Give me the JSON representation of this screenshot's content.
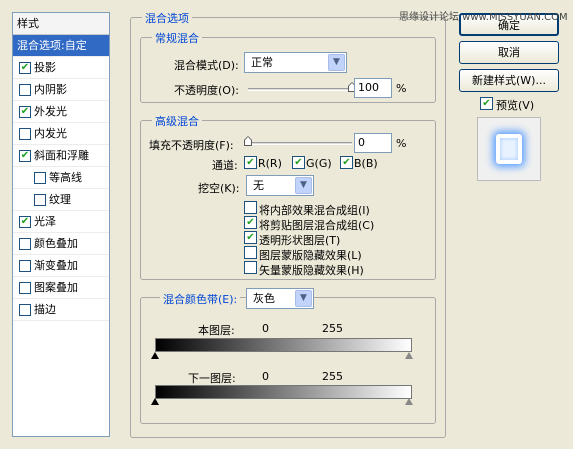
{
  "style_list": {
    "header": "样式",
    "items": [
      {
        "label": "混合选项:自定",
        "selected": true
      },
      {
        "label": "投影",
        "checked": true
      },
      {
        "label": "内阴影",
        "checked": false
      },
      {
        "label": "外发光",
        "checked": true
      },
      {
        "label": "内发光",
        "checked": false
      },
      {
        "label": "斜面和浮雕",
        "checked": true
      },
      {
        "label": "等高线",
        "checked": false
      },
      {
        "label": "纹理",
        "checked": false
      },
      {
        "label": "光泽",
        "checked": true
      },
      {
        "label": "颜色叠加",
        "checked": false
      },
      {
        "label": "渐变叠加",
        "checked": false
      },
      {
        "label": "图案叠加",
        "checked": false
      },
      {
        "label": "描边",
        "checked": false
      }
    ]
  },
  "blending": {
    "title": "混合选项",
    "general": {
      "title": "常规混合",
      "mode_label": "混合模式(D):",
      "mode_value": "正常",
      "opacity_label": "不透明度(O):",
      "opacity_value": "100",
      "opacity_fraction": 1.0,
      "percent": "%"
    },
    "advanced": {
      "title": "高级混合",
      "fill_label": "填充不透明度(F):",
      "fill_value": "0",
      "fill_fraction": 0.0,
      "percent": "%",
      "channels_label": "通道:",
      "channels": [
        {
          "label": "R(R)",
          "checked": true
        },
        {
          "label": "G(G)",
          "checked": true
        },
        {
          "label": "B(B)",
          "checked": true
        }
      ],
      "knockout_label": "挖空(K):",
      "knockout_value": "无",
      "options": [
        {
          "label": "将内部效果混合成组(I)",
          "checked": false
        },
        {
          "label": "将剪贴图层混合成组(C)",
          "checked": true
        },
        {
          "label": "透明形状图层(T)",
          "checked": true
        },
        {
          "label": "图层蒙版隐藏效果(L)",
          "checked": false
        },
        {
          "label": "矢量蒙版隐藏效果(H)",
          "checked": false
        }
      ]
    },
    "blend_if": {
      "label": "混合颜色带(E):",
      "value": "灰色",
      "this_layer": {
        "label": "本图层:",
        "low": "0",
        "high": "255"
      },
      "underlying": {
        "label": "下一图层:",
        "low": "0",
        "high": "255"
      }
    }
  },
  "buttons": {
    "ok": "确定",
    "cancel": "取消",
    "new_style": "新建样式(W)...",
    "preview_label": "预览(V)",
    "preview_checked": true
  },
  "watermark": "思缘设计论坛 www.MISSYUAN.COM",
  "colors": {
    "accent": "#316ac5",
    "group_title": "#0046d5"
  }
}
